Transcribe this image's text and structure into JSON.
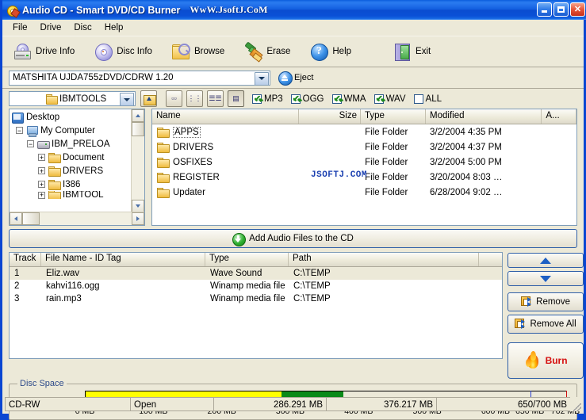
{
  "window": {
    "title": "Audio CD - Smart DVD/CD Burner",
    "watermark": "WwW.JsoftJ.CoM",
    "icon": "cd-disc-icon",
    "buttons": {
      "minimize": "minimize-button",
      "maximize": "maximize-button",
      "close": "close-button"
    }
  },
  "menu": {
    "items": [
      {
        "label": "File"
      },
      {
        "label": "Drive"
      },
      {
        "label": "Disc"
      },
      {
        "label": "Help"
      }
    ]
  },
  "toolbar": {
    "buttons": [
      {
        "label": "Drive Info",
        "icon": "drive-info-icon"
      },
      {
        "label": "Disc Info",
        "icon": "disc-info-icon"
      },
      {
        "label": "Browse",
        "icon": "browse-folder-icon"
      },
      {
        "label": "Erase",
        "icon": "erase-broom-icon"
      },
      {
        "label": "Help",
        "icon": "help-question-icon"
      },
      {
        "label": "Exit",
        "icon": "exit-door-icon"
      }
    ]
  },
  "drive": {
    "selected": "MATSHITA  UJDA755zDVD/CDRW  1.20",
    "eject_label": "Eject",
    "eject_icon": "eject-icon"
  },
  "path": {
    "current_folder": "IBMTOOLS",
    "folder_icon": "folder-icon",
    "up_button": "up-one-level-icon",
    "view_modes": [
      {
        "name": "large-icons-view",
        "selected": false
      },
      {
        "name": "small-icons-view",
        "selected": false
      },
      {
        "name": "list-view",
        "selected": false
      },
      {
        "name": "details-view",
        "selected": true
      }
    ]
  },
  "filters": [
    {
      "label": "MP3",
      "checked": true
    },
    {
      "label": "OGG",
      "checked": true
    },
    {
      "label": "WMA",
      "checked": true
    },
    {
      "label": "WAV",
      "checked": true
    },
    {
      "label": "ALL",
      "checked": false
    }
  ],
  "tree": {
    "nodes": [
      {
        "label": "Desktop",
        "depth": 0,
        "icon": "desktop-icon",
        "expander": ""
      },
      {
        "label": "My Computer",
        "depth": 1,
        "icon": "my-computer-icon",
        "expander": "-"
      },
      {
        "label": "IBM_PRELOA",
        "depth": 2,
        "icon": "hard-drive-icon",
        "expander": "-"
      },
      {
        "label": "Document",
        "depth": 3,
        "icon": "folder-icon",
        "expander": "+"
      },
      {
        "label": "DRIVERS",
        "depth": 3,
        "icon": "folder-icon",
        "expander": "+"
      },
      {
        "label": "I386",
        "depth": 3,
        "icon": "folder-icon",
        "expander": "+"
      },
      {
        "label": "IBMTOOL",
        "depth": 3,
        "icon": "folder-icon",
        "expander": "+"
      }
    ]
  },
  "file_list": {
    "columns": [
      "Name",
      "Size",
      "Type",
      "Modified",
      "A..."
    ],
    "watermark": "JSOFTJ.COM",
    "rows": [
      {
        "name": "APPS",
        "size": "",
        "type": "File Folder",
        "modified": "3/2/2004   4:35 PM",
        "attr": "",
        "selected": true
      },
      {
        "name": "DRIVERS",
        "size": "",
        "type": "File Folder",
        "modified": "3/2/2004   4:37 PM",
        "attr": "",
        "selected": false
      },
      {
        "name": "OSFIXES",
        "size": "",
        "type": "File Folder",
        "modified": "3/2/2004   5:00 PM",
        "attr": "",
        "selected": false
      },
      {
        "name": "REGISTER",
        "size": "",
        "type": "File Folder",
        "modified": "3/20/2004   8:03 …",
        "attr": "",
        "selected": false
      },
      {
        "name": "Updater",
        "size": "",
        "type": "File Folder",
        "modified": "6/28/2004   9:02 …",
        "attr": "",
        "selected": false
      }
    ]
  },
  "add_button": {
    "label": "Add Audio Files to the CD",
    "icon": "green-down-arrow-icon"
  },
  "track_list": {
    "columns": [
      "Track",
      "File Name - ID Tag",
      "Type",
      "Path"
    ],
    "rows": [
      {
        "track": "1",
        "file": "Eliz.wav",
        "type": "Wave Sound",
        "path": "C:\\TEMP",
        "selected": true
      },
      {
        "track": "2",
        "file": "kahvi116.ogg",
        "type": "Winamp media file",
        "path": "C:\\TEMP",
        "selected": false
      },
      {
        "track": "3",
        "file": "rain.mp3",
        "type": "Winamp media file",
        "path": "C:\\TEMP",
        "selected": false
      }
    ]
  },
  "side_buttons": {
    "move_up": "move-up-button",
    "move_down": "move-down-button",
    "remove_label": "Remove",
    "remove_all_label": "Remove All",
    "burn_label": "Burn",
    "burn_icon": "flame-icon"
  },
  "disc_space": {
    "legend": "Disc Space",
    "axis_max_mb": 702,
    "used_yellow_mb": 286.291,
    "used_green_mb": 376.217,
    "marker_blue_mb": 650,
    "marker_red_mb": 702,
    "colors": {
      "yellow": "#ffff00",
      "green": "#0a8a18",
      "blue_marker": "#2a3fd0",
      "red_marker": "#d01010"
    },
    "ticks": [
      {
        "mb": 0,
        "label": "0 MB"
      },
      {
        "mb": 100,
        "label": "100 MB"
      },
      {
        "mb": 200,
        "label": "200 MB"
      },
      {
        "mb": 300,
        "label": "300 MB"
      },
      {
        "mb": 400,
        "label": "400 MB"
      },
      {
        "mb": 500,
        "label": "500 MB"
      },
      {
        "mb": 600,
        "label": "600 MB"
      },
      {
        "mb": 650,
        "label": "650 MB"
      },
      {
        "mb": 702,
        "label": "702 MB"
      }
    ]
  },
  "status_bar": {
    "disc_type": "CD-RW",
    "disc_state": "Open",
    "size_used": "286.291 MB",
    "size_total": "376.217 MB",
    "capacity": "650/700 MB"
  }
}
